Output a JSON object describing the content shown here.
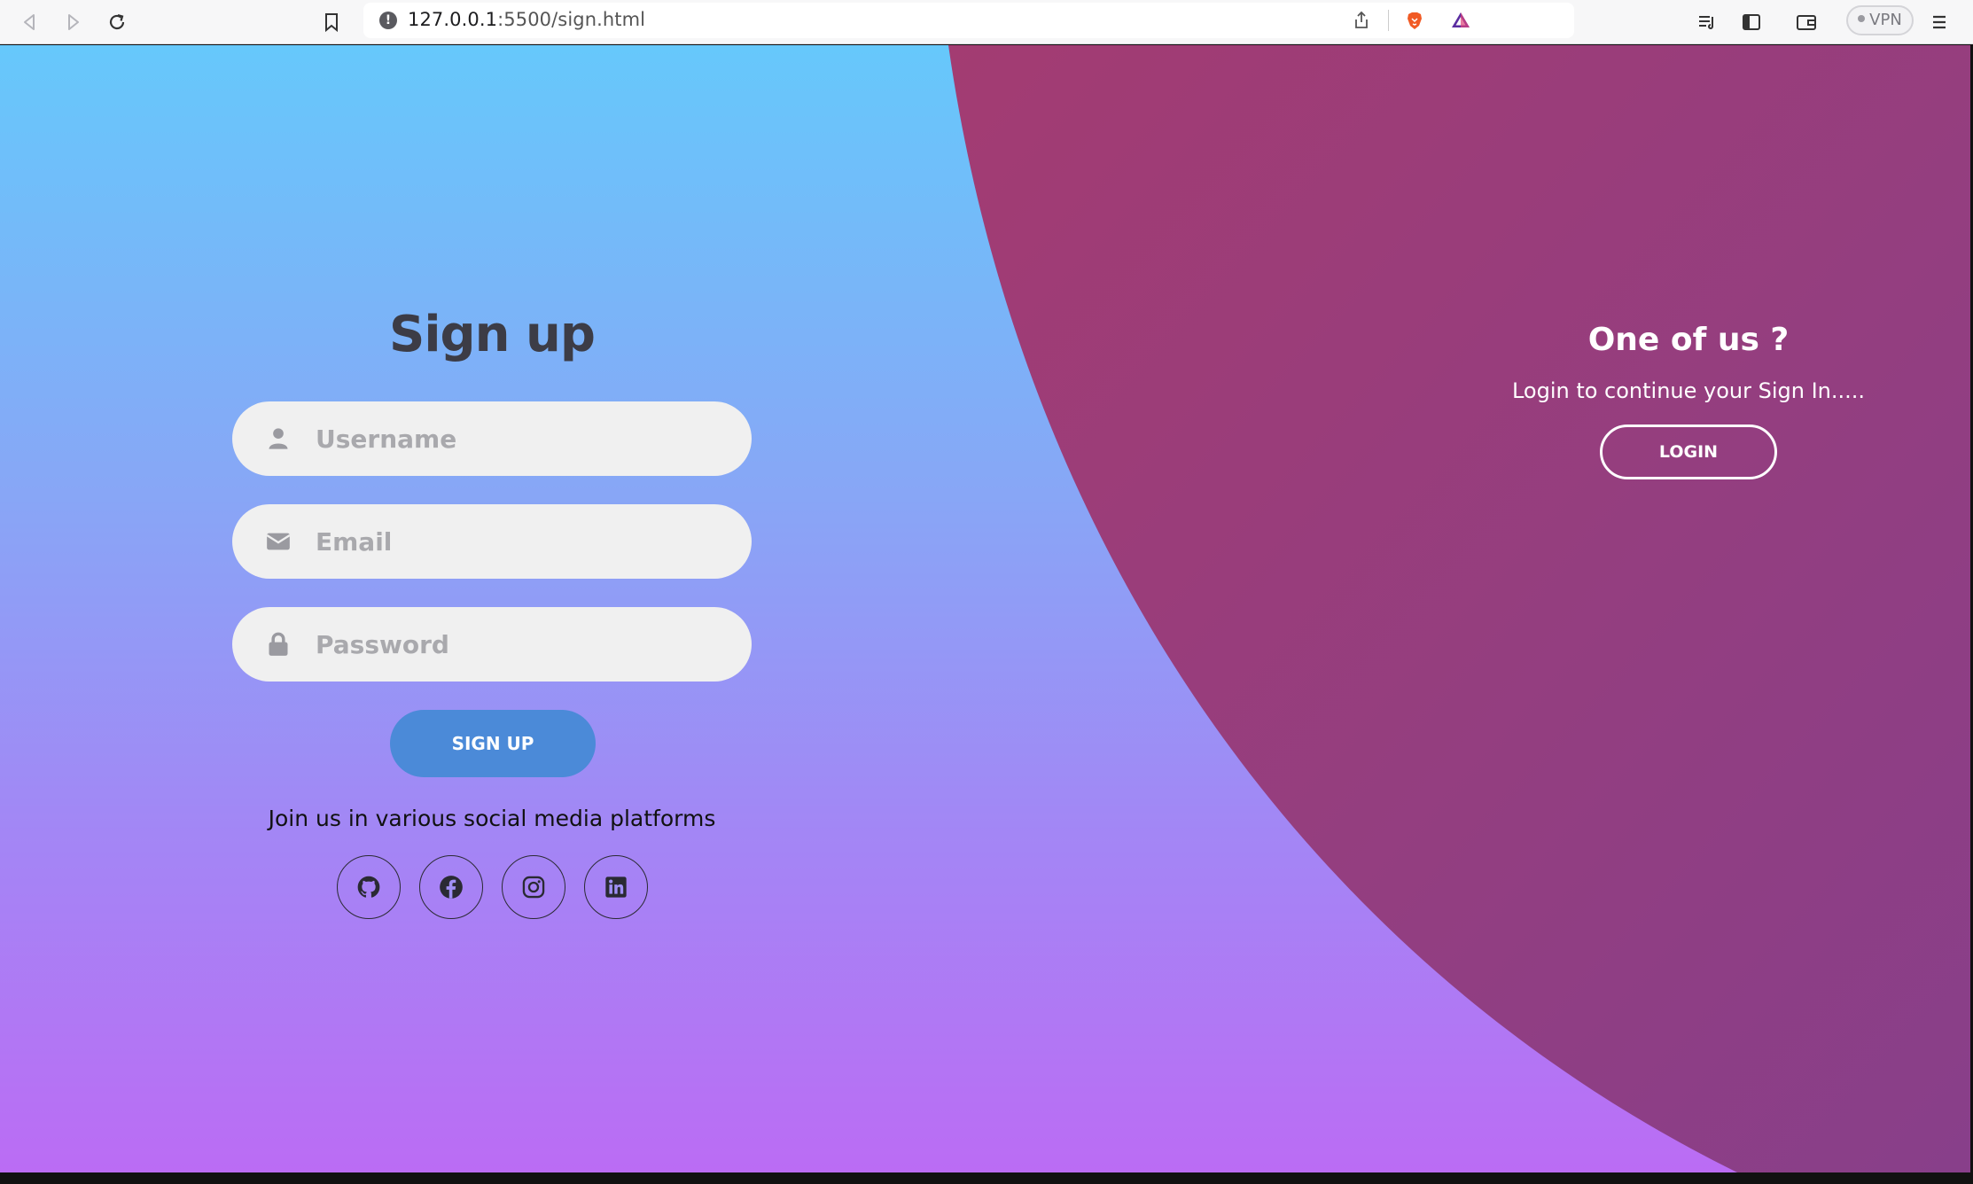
{
  "browser": {
    "url_host": "127.0.0.1",
    "url_path": ":5500/sign.html",
    "vpn_label": "VPN"
  },
  "signup": {
    "title": "Sign up",
    "username_placeholder": "Username",
    "email_placeholder": "Email",
    "password_placeholder": "Password",
    "submit_label": "SIGN UP",
    "social_text": "Join us in various social media platforms",
    "social_icons": [
      "github-icon",
      "facebook-icon",
      "instagram-icon",
      "linkedin-icon"
    ]
  },
  "login": {
    "title": "One of us ?",
    "subtitle": "Login to continue your Sign In.....",
    "button_label": "LOGIN"
  },
  "colors": {
    "gradient_top": "#66c8fb",
    "gradient_bottom": "#bb6cf4",
    "panel_magenta": "#9a3c7c",
    "signup_button": "#4b8ad8",
    "field_bg": "#f0f0f0",
    "title_text": "#3c3c46"
  }
}
